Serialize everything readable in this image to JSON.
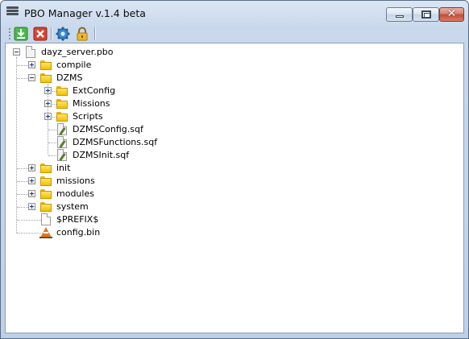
{
  "window": {
    "title": "PBO Manager v.1.4 beta",
    "controls": {
      "minimize": "minimize",
      "maximize": "maximize",
      "close": "✕"
    }
  },
  "toolbar": {
    "buttons": [
      {
        "icon": "extract-icon",
        "color": "#3aa53a"
      },
      {
        "icon": "delete-icon",
        "color": "#d43a2c"
      },
      {
        "icon": "settings-gear-icon",
        "color": "#3b86c8"
      },
      {
        "icon": "lock-icon",
        "color": "#e0a81c"
      }
    ]
  },
  "tree": {
    "root": {
      "label": "dayz_server.pbo",
      "expanded": true
    },
    "items": [
      {
        "label": "compile",
        "type": "folder",
        "expanded": false
      },
      {
        "label": "DZMS",
        "type": "folder",
        "expanded": true,
        "children": [
          {
            "label": "ExtConfig",
            "type": "folder",
            "expanded": false
          },
          {
            "label": "Missions",
            "type": "folder",
            "expanded": false
          },
          {
            "label": "Scripts",
            "type": "folder",
            "expanded": false
          },
          {
            "label": "DZMSConfig.sqf",
            "type": "sqf-file"
          },
          {
            "label": "DZMSFunctions.sqf",
            "type": "sqf-file"
          },
          {
            "label": "DZMSInit.sqf",
            "type": "sqf-file"
          }
        ]
      },
      {
        "label": "init",
        "type": "folder",
        "expanded": false
      },
      {
        "label": "missions",
        "type": "folder",
        "expanded": false
      },
      {
        "label": "modules",
        "type": "folder",
        "expanded": false
      },
      {
        "label": "system",
        "type": "folder",
        "expanded": false
      },
      {
        "label": "$PREFIX$",
        "type": "file"
      },
      {
        "label": "config.bin",
        "type": "config-bin"
      }
    ]
  }
}
